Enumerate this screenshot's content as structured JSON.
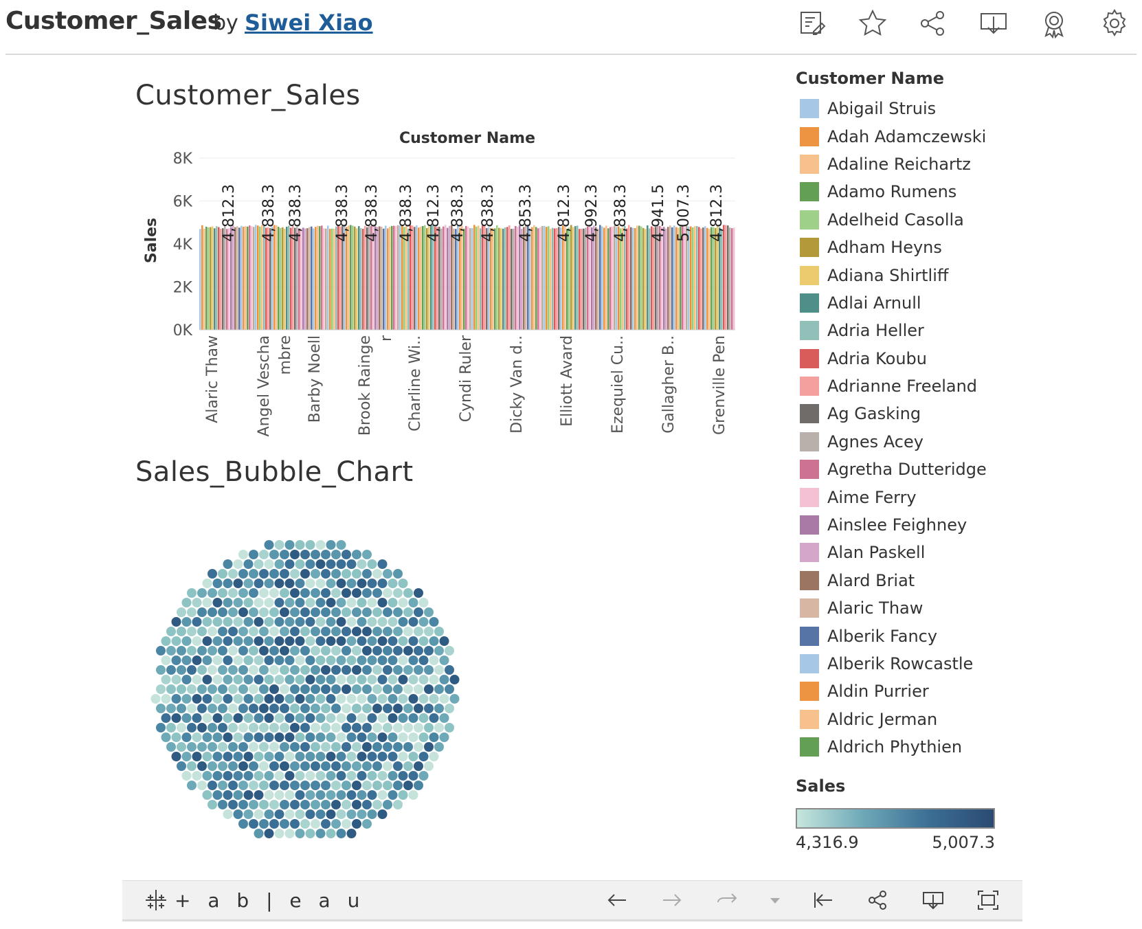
{
  "header": {
    "title": "Customer_Sales",
    "by": "by",
    "author": "Siwei Xiao",
    "icons": [
      "edit-icon",
      "favorite-star-icon",
      "share-icon",
      "download-icon",
      "badge-icon",
      "settings-gear-icon"
    ]
  },
  "sheets": {
    "bar_title": "Customer_Sales",
    "bubble_title": "Sales_Bubble_Chart"
  },
  "chart_data": [
    {
      "type": "bar",
      "title": "Customer_Sales",
      "xlabel": "Customer Name",
      "ylabel": "Sales",
      "ylim": [
        0,
        8000
      ],
      "yticks": [
        "0K",
        "2K",
        "4K",
        "6K",
        "8K"
      ],
      "category_labels": [
        "Alaric Thaw",
        "Angel Vescha",
        "mbre",
        "Barby Noell",
        "Brook Rainge",
        "r",
        "Charline Wi..",
        "Cyndi Ruler",
        "Dicky Van d..",
        "Elliott Avard",
        "Ezequiel Cu..",
        "Gallagher B..",
        "Grenville Pen"
      ],
      "data_labels": [
        "4,812.3",
        "4,838.3",
        "4,838.3",
        "4,838.3",
        "4,838.3",
        "4,838.3",
        "4,812.3",
        "4,838.3",
        "4,838.3",
        "4,853.3",
        "4,812.3",
        "4,992.3",
        "4,838.3",
        "4,941.5",
        "5,007.3",
        "4,812.3"
      ],
      "value_range": [
        4316.9,
        5007.3
      ],
      "grid": true,
      "legend": "right"
    },
    {
      "type": "scatter",
      "title": "Sales_Bubble_Chart",
      "encoding": "packed bubbles colored by Sales",
      "color_range": [
        4316.9,
        5007.3
      ]
    }
  ],
  "legend": {
    "title": "Customer Name",
    "items": [
      {
        "label": "Abigail Struis",
        "color": "#a6c8e6"
      },
      {
        "label": "Adah Adamczewski",
        "color": "#ed9442"
      },
      {
        "label": "Adaline Reichartz",
        "color": "#f6c18d"
      },
      {
        "label": "Adamo Rumens",
        "color": "#63a056"
      },
      {
        "label": "Adelheid Casolla",
        "color": "#9fd08a"
      },
      {
        "label": "Adham Heyns",
        "color": "#b4993a"
      },
      {
        "label": "Adiana Shirtliff",
        "color": "#eccb6e"
      },
      {
        "label": "Adlai Arnull",
        "color": "#4e9089"
      },
      {
        "label": "Adria Heller",
        "color": "#91c0b9"
      },
      {
        "label": "Adria Koubu",
        "color": "#d95b5a"
      },
      {
        "label": "Adrianne Freeland",
        "color": "#f4a09e"
      },
      {
        "label": "Ag Gasking",
        "color": "#706c6a"
      },
      {
        "label": "Agnes Acey",
        "color": "#bab0ab"
      },
      {
        "label": "Agretha Dutteridge",
        "color": "#cd7292"
      },
      {
        "label": "Aime Ferry",
        "color": "#f4c1d4"
      },
      {
        "label": "Ainslee Feighney",
        "color": "#a97aa5"
      },
      {
        "label": "Alan Paskell",
        "color": "#d4a6ca"
      },
      {
        "label": "Alard Briat",
        "color": "#9b7561"
      },
      {
        "label": "Alaric Thaw",
        "color": "#d7b6a4"
      },
      {
        "label": "Alberik Fancy",
        "color": "#5674a6"
      },
      {
        "label": "Alberik Rowcastle",
        "color": "#a6c8e6"
      },
      {
        "label": "Aldin Purrier",
        "color": "#ed9442"
      },
      {
        "label": "Aldric Jerman",
        "color": "#f6c18d"
      },
      {
        "label": "Aldrich Phythien",
        "color": "#63a056"
      }
    ]
  },
  "sales_legend": {
    "title": "Sales",
    "min_label": "4,316.9",
    "max_label": "5,007.3",
    "colors": [
      "#c7e6dd",
      "#2b4a72"
    ]
  },
  "footer": {
    "logo_text": "+ a b | e a u",
    "buttons": [
      "back-arrow-icon",
      "forward-arrow-icon",
      "redo-icon",
      "dropdown-caret-icon",
      "reset-first-icon",
      "share-icon",
      "download-icon",
      "fullscreen-icon"
    ]
  }
}
